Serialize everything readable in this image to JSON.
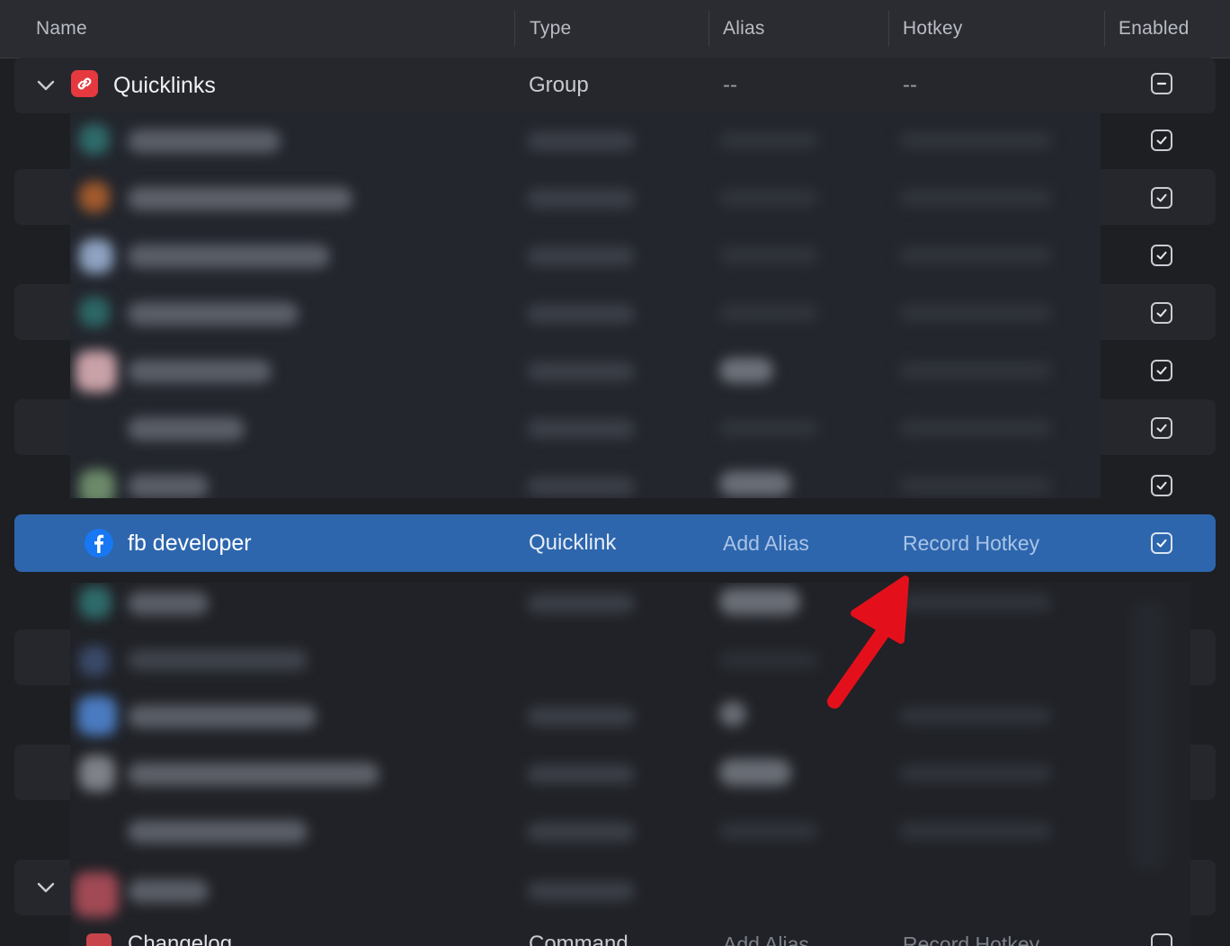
{
  "columns": {
    "name": "Name",
    "type": "Type",
    "alias": "Alias",
    "hotkey": "Hotkey",
    "enabled": "Enabled"
  },
  "group_row": {
    "name": "Quicklinks",
    "type": "Group",
    "alias": "--",
    "hotkey": "--",
    "enabled_state": "mixed",
    "icon": "link-icon"
  },
  "selected_row": {
    "name": "fb developer",
    "type": "Quicklink",
    "alias_placeholder": "Add Alias",
    "hotkey_placeholder": "Record Hotkey",
    "enabled": true,
    "icon": "facebook-icon"
  },
  "bottom_row": {
    "name": "Changelog",
    "type": "Command",
    "alias_placeholder": "Add Alias",
    "hotkey_placeholder": "Record Hotkey"
  },
  "colors": {
    "accent": "#2d66ad",
    "annotation_arrow": "#e3101b",
    "background": "#1d1f23"
  }
}
